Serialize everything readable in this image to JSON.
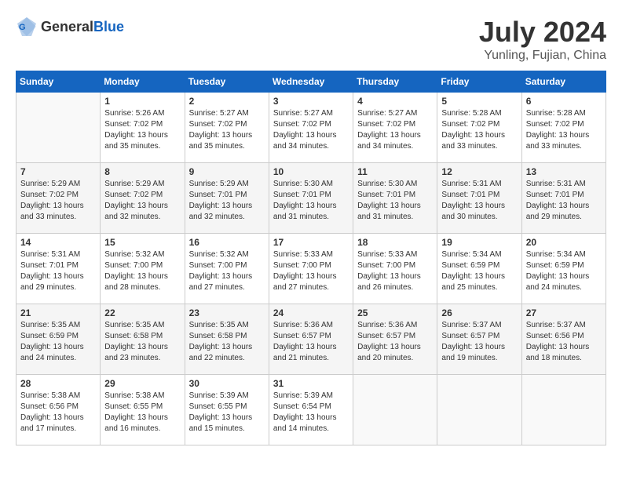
{
  "header": {
    "logo_general": "General",
    "logo_blue": "Blue",
    "month_year": "July 2024",
    "location": "Yunling, Fujian, China"
  },
  "days_of_week": [
    "Sunday",
    "Monday",
    "Tuesday",
    "Wednesday",
    "Thursday",
    "Friday",
    "Saturday"
  ],
  "weeks": [
    [
      {
        "day": "",
        "info": ""
      },
      {
        "day": "1",
        "info": "Sunrise: 5:26 AM\nSunset: 7:02 PM\nDaylight: 13 hours\nand 35 minutes."
      },
      {
        "day": "2",
        "info": "Sunrise: 5:27 AM\nSunset: 7:02 PM\nDaylight: 13 hours\nand 35 minutes."
      },
      {
        "day": "3",
        "info": "Sunrise: 5:27 AM\nSunset: 7:02 PM\nDaylight: 13 hours\nand 34 minutes."
      },
      {
        "day": "4",
        "info": "Sunrise: 5:27 AM\nSunset: 7:02 PM\nDaylight: 13 hours\nand 34 minutes."
      },
      {
        "day": "5",
        "info": "Sunrise: 5:28 AM\nSunset: 7:02 PM\nDaylight: 13 hours\nand 33 minutes."
      },
      {
        "day": "6",
        "info": "Sunrise: 5:28 AM\nSunset: 7:02 PM\nDaylight: 13 hours\nand 33 minutes."
      }
    ],
    [
      {
        "day": "7",
        "info": "Sunrise: 5:29 AM\nSunset: 7:02 PM\nDaylight: 13 hours\nand 33 minutes."
      },
      {
        "day": "8",
        "info": "Sunrise: 5:29 AM\nSunset: 7:02 PM\nDaylight: 13 hours\nand 32 minutes."
      },
      {
        "day": "9",
        "info": "Sunrise: 5:29 AM\nSunset: 7:01 PM\nDaylight: 13 hours\nand 32 minutes."
      },
      {
        "day": "10",
        "info": "Sunrise: 5:30 AM\nSunset: 7:01 PM\nDaylight: 13 hours\nand 31 minutes."
      },
      {
        "day": "11",
        "info": "Sunrise: 5:30 AM\nSunset: 7:01 PM\nDaylight: 13 hours\nand 31 minutes."
      },
      {
        "day": "12",
        "info": "Sunrise: 5:31 AM\nSunset: 7:01 PM\nDaylight: 13 hours\nand 30 minutes."
      },
      {
        "day": "13",
        "info": "Sunrise: 5:31 AM\nSunset: 7:01 PM\nDaylight: 13 hours\nand 29 minutes."
      }
    ],
    [
      {
        "day": "14",
        "info": "Sunrise: 5:31 AM\nSunset: 7:01 PM\nDaylight: 13 hours\nand 29 minutes."
      },
      {
        "day": "15",
        "info": "Sunrise: 5:32 AM\nSunset: 7:00 PM\nDaylight: 13 hours\nand 28 minutes."
      },
      {
        "day": "16",
        "info": "Sunrise: 5:32 AM\nSunset: 7:00 PM\nDaylight: 13 hours\nand 27 minutes."
      },
      {
        "day": "17",
        "info": "Sunrise: 5:33 AM\nSunset: 7:00 PM\nDaylight: 13 hours\nand 27 minutes."
      },
      {
        "day": "18",
        "info": "Sunrise: 5:33 AM\nSunset: 7:00 PM\nDaylight: 13 hours\nand 26 minutes."
      },
      {
        "day": "19",
        "info": "Sunrise: 5:34 AM\nSunset: 6:59 PM\nDaylight: 13 hours\nand 25 minutes."
      },
      {
        "day": "20",
        "info": "Sunrise: 5:34 AM\nSunset: 6:59 PM\nDaylight: 13 hours\nand 24 minutes."
      }
    ],
    [
      {
        "day": "21",
        "info": "Sunrise: 5:35 AM\nSunset: 6:59 PM\nDaylight: 13 hours\nand 24 minutes."
      },
      {
        "day": "22",
        "info": "Sunrise: 5:35 AM\nSunset: 6:58 PM\nDaylight: 13 hours\nand 23 minutes."
      },
      {
        "day": "23",
        "info": "Sunrise: 5:35 AM\nSunset: 6:58 PM\nDaylight: 13 hours\nand 22 minutes."
      },
      {
        "day": "24",
        "info": "Sunrise: 5:36 AM\nSunset: 6:57 PM\nDaylight: 13 hours\nand 21 minutes."
      },
      {
        "day": "25",
        "info": "Sunrise: 5:36 AM\nSunset: 6:57 PM\nDaylight: 13 hours\nand 20 minutes."
      },
      {
        "day": "26",
        "info": "Sunrise: 5:37 AM\nSunset: 6:57 PM\nDaylight: 13 hours\nand 19 minutes."
      },
      {
        "day": "27",
        "info": "Sunrise: 5:37 AM\nSunset: 6:56 PM\nDaylight: 13 hours\nand 18 minutes."
      }
    ],
    [
      {
        "day": "28",
        "info": "Sunrise: 5:38 AM\nSunset: 6:56 PM\nDaylight: 13 hours\nand 17 minutes."
      },
      {
        "day": "29",
        "info": "Sunrise: 5:38 AM\nSunset: 6:55 PM\nDaylight: 13 hours\nand 16 minutes."
      },
      {
        "day": "30",
        "info": "Sunrise: 5:39 AM\nSunset: 6:55 PM\nDaylight: 13 hours\nand 15 minutes."
      },
      {
        "day": "31",
        "info": "Sunrise: 5:39 AM\nSunset: 6:54 PM\nDaylight: 13 hours\nand 14 minutes."
      },
      {
        "day": "",
        "info": ""
      },
      {
        "day": "",
        "info": ""
      },
      {
        "day": "",
        "info": ""
      }
    ]
  ]
}
